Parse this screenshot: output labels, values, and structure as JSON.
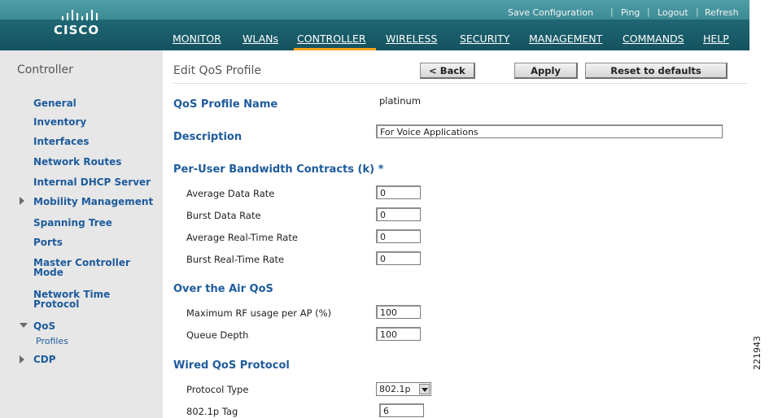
{
  "header": {
    "brand": "CISCO",
    "top_links": [
      "Save Configuration",
      "Ping",
      "Logout",
      "Refresh"
    ],
    "nav": [
      "MONITOR",
      "WLANs",
      "CONTROLLER",
      "WIRELESS",
      "SECURITY",
      "MANAGEMENT",
      "COMMANDS",
      "HELP"
    ],
    "active_nav": "CONTROLLER",
    "colors": {
      "strip": "#4f9fa7",
      "menubar": "#1a5f6c",
      "active_underline": "#f7a21b"
    }
  },
  "sidebar": {
    "title": "Controller",
    "items": [
      {
        "label": "General"
      },
      {
        "label": "Inventory"
      },
      {
        "label": "Interfaces"
      },
      {
        "label": "Network Routes"
      },
      {
        "label": "Internal DHCP Server"
      },
      {
        "label": "Mobility Management",
        "expand": "collapsed"
      },
      {
        "label": "Spanning Tree"
      },
      {
        "label": "Ports"
      },
      {
        "label": "Master Controller Mode"
      },
      {
        "label": "Network Time Protocol"
      },
      {
        "label": "QoS",
        "expand": "expanded",
        "sub": "Profiles"
      },
      {
        "label": "CDP",
        "expand": "collapsed"
      }
    ]
  },
  "main": {
    "title": "Edit QoS Profile",
    "buttons": {
      "back": "< Back",
      "apply": "Apply",
      "reset": "Reset to defaults"
    },
    "profile_name_label": "QoS Profile Name",
    "profile_name_value": "platinum",
    "description_label": "Description",
    "description_value": "For Voice Applications",
    "bandwidth": {
      "heading": "Per-User Bandwidth Contracts (k) *",
      "rows": [
        {
          "label": "Average Data Rate",
          "value": "0"
        },
        {
          "label": "Burst Data Rate",
          "value": "0"
        },
        {
          "label": "Average Real-Time Rate",
          "value": "0"
        },
        {
          "label": "Burst Real-Time Rate",
          "value": "0"
        }
      ]
    },
    "air_qos": {
      "heading": "Over the Air QoS",
      "rows": [
        {
          "label": "Maximum RF usage per AP (%)",
          "value": "100"
        },
        {
          "label": "Queue Depth",
          "value": "100"
        }
      ]
    },
    "wired_qos": {
      "heading": "Wired QoS Protocol",
      "protocol_label": "Protocol Type",
      "protocol_value": "802.1p",
      "tag_label": "802.1p Tag",
      "tag_value": "6"
    }
  },
  "figure_id": "221943"
}
